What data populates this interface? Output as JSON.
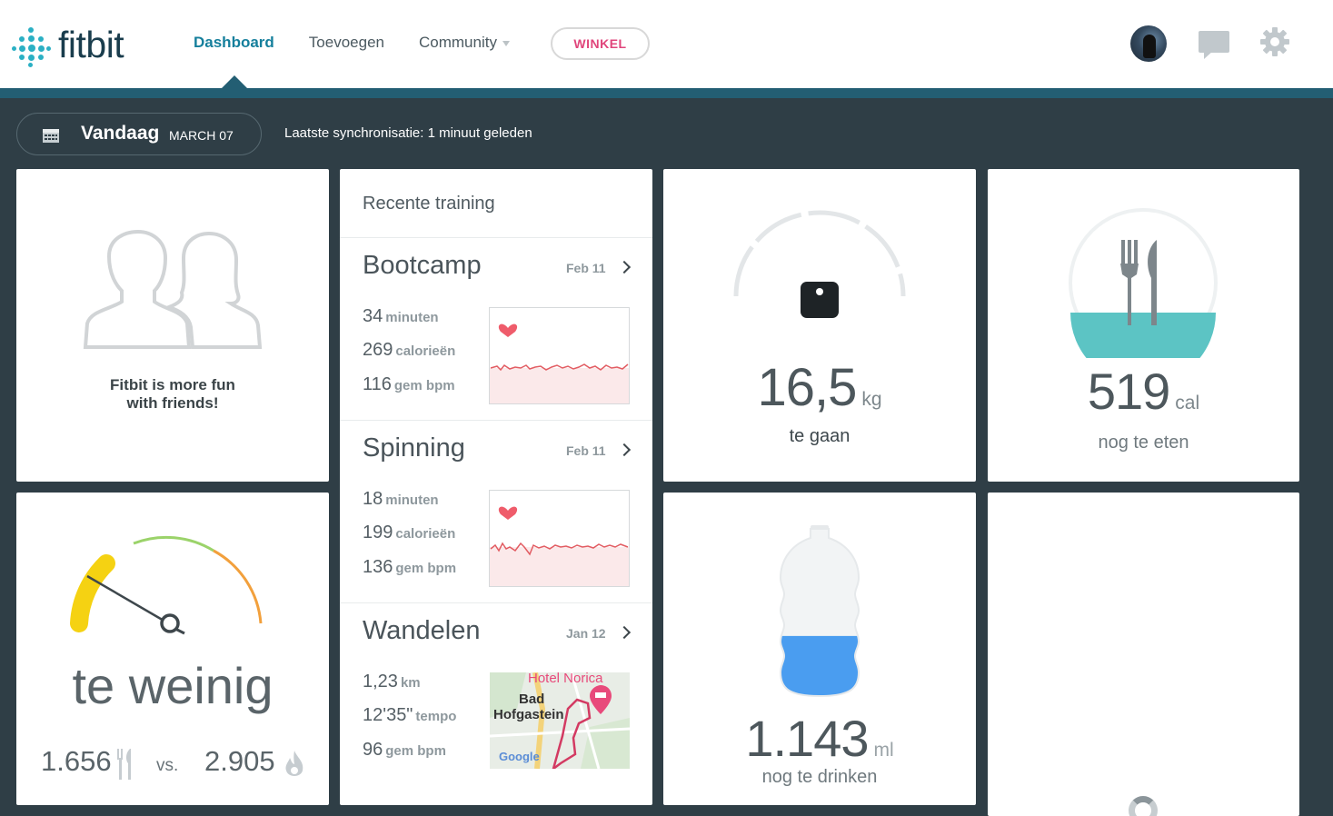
{
  "header": {
    "logo_text": "fitbit",
    "nav": [
      {
        "label": "Dashboard",
        "active": true
      },
      {
        "label": "Toevoegen",
        "active": false
      },
      {
        "label": "Community",
        "active": false,
        "has_dropdown": true
      }
    ],
    "store_label": "WINKEL",
    "icons": [
      "avatar",
      "chat-icon",
      "gear-icon"
    ],
    "colors": {
      "brand": "#2bb0c4",
      "active_nav": "#157f9c",
      "store": "#e0457b",
      "accent_bar": "#235e73"
    }
  },
  "datebar": {
    "today": "Vandaag",
    "date": "MARCH 07",
    "sync": "Laatste synchronisatie: 1 minuut geleden"
  },
  "friends": {
    "message_line1": "Fitbit is more fun",
    "message_line2": "with friends!"
  },
  "recent_training": {
    "title": "Recente training",
    "items": [
      {
        "name": "Bootcamp",
        "date": "Feb 11",
        "stats": [
          {
            "value": "34",
            "unit": "minuten"
          },
          {
            "value": "269",
            "unit": "calorieën"
          },
          {
            "value": "116",
            "unit": "gem bpm"
          }
        ]
      },
      {
        "name": "Spinning",
        "date": "Feb 11",
        "stats": [
          {
            "value": "18",
            "unit": "minuten"
          },
          {
            "value": "199",
            "unit": "calorieën"
          },
          {
            "value": "136",
            "unit": "gem bpm"
          }
        ]
      },
      {
        "name": "Wandelen",
        "date": "Jan 12",
        "stats": [
          {
            "value": "1,23",
            "unit": "km"
          },
          {
            "value": "12'35\"",
            "unit": "tempo"
          },
          {
            "value": "96",
            "unit": "gem bpm"
          }
        ],
        "map_labels": {
          "poi": "Hotel Norica",
          "town_line1": "Bad",
          "town_line2": "Hofgastein",
          "provider": "Google"
        }
      }
    ]
  },
  "weight": {
    "value": "16,5",
    "unit": "kg",
    "label": "te gaan"
  },
  "food": {
    "value": "519",
    "unit": "cal",
    "label": "nog te eten",
    "fill_fraction": 0.3
  },
  "calorie_balance": {
    "status": "te weinig",
    "calories_in": "1.656",
    "vs": "vs.",
    "calories_out": "2.905"
  },
  "water": {
    "value": "1.143",
    "unit": "ml",
    "label": "nog te drinken",
    "fill_fraction": 0.38
  }
}
